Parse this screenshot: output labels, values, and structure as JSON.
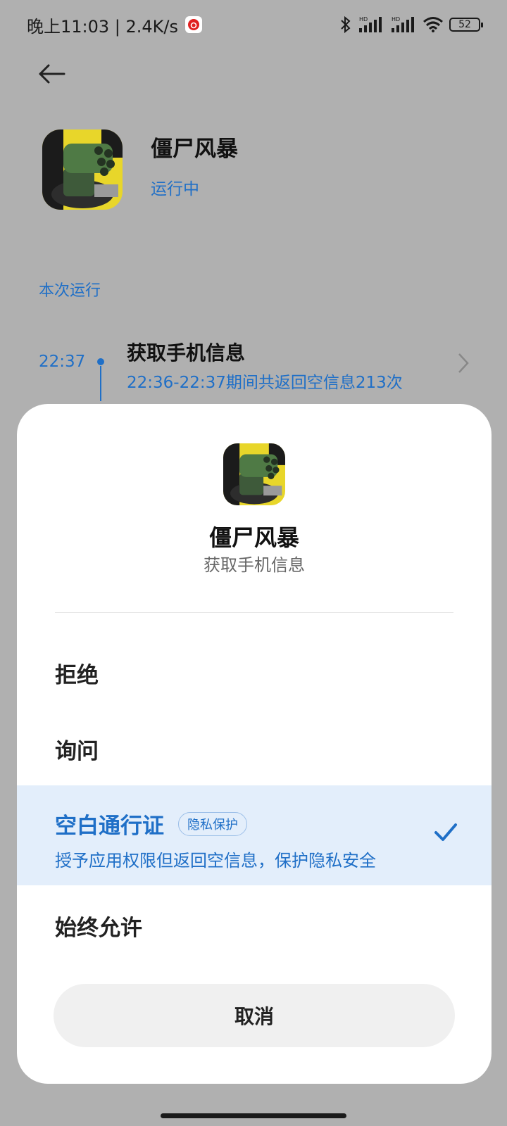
{
  "status_bar": {
    "time_speed": "晚上11:03 | 2.4K/s",
    "battery": "52",
    "icons": [
      "netease-music-icon",
      "bluetooth-icon",
      "signal-hd-icon",
      "signal-hd-icon",
      "wifi-icon",
      "battery-icon"
    ]
  },
  "app": {
    "name": "僵尸风暴",
    "status": "运行中"
  },
  "section": {
    "label": "本次运行"
  },
  "event": {
    "time": "22:37",
    "title": "获取手机信息",
    "desc": "22:36-22:37期间共返回空信息213次"
  },
  "dialog": {
    "app_name": "僵尸风暴",
    "permission": "获取手机信息",
    "options": {
      "deny": "拒绝",
      "ask": "询问",
      "blank_pass": "空白通行证",
      "blank_pass_badge": "隐私保护",
      "blank_pass_desc": "授予应用权限但返回空信息，保护隐私安全",
      "always_allow": "始终允许"
    },
    "selected": "blank_pass",
    "cancel_label": "取消"
  },
  "colors": {
    "accent": "#1f6fc7",
    "selected_bg": "#e3eefb",
    "overlay_bg": "#b0b0b0"
  }
}
